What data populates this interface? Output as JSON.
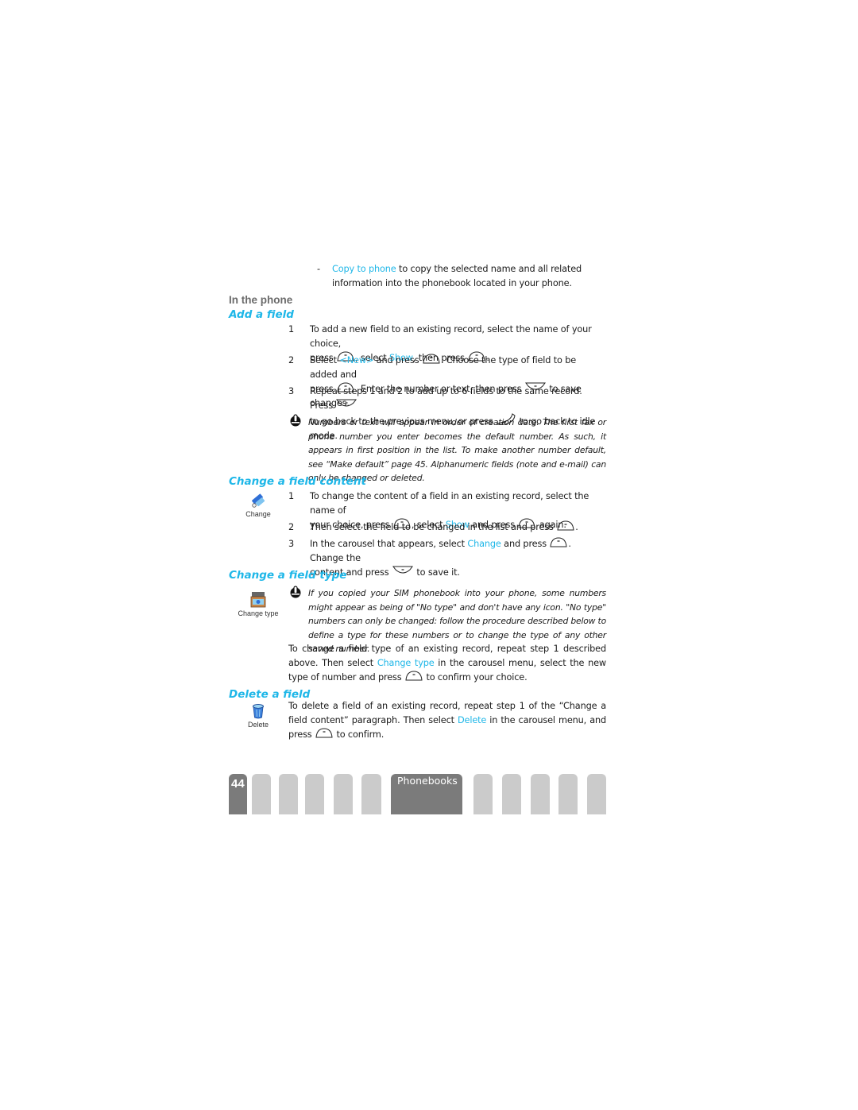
{
  "intro_bullet": {
    "dash": "-",
    "link": "Copy to phone",
    "text_1": " to copy the selected name and all related",
    "text_2": "information into the phonebook located in your phone."
  },
  "subsection": "In the phone",
  "add_field": {
    "title": "Add a field",
    "steps": [
      {
        "num": "1",
        "a": "To add a new field to an existing record, select the name of your choice,",
        "b": "press",
        "c": ", select ",
        "link": "Show",
        "d": ", then press",
        "e": "."
      },
      {
        "num": "2",
        "a": "Select ",
        "link": "<New>",
        "b": " and press",
        "c": ". Choose the type of field to be added and",
        "d": "press",
        "e": ". Enter the number or text, then press",
        "f": "to save changes."
      },
      {
        "num": "3",
        "a": "Repeat steps 1 and 2 to add up to 6 fields to the same record. Press",
        "b": "to go back to the previous menu, or press",
        "c": "to go back to idle mode."
      }
    ],
    "note": "Numbers or text will appear in order of creation date. The first fax or phone number you enter becomes the default number. As such, it appears in first position in the list. To make another number default, see “Make default” page 45. Alphanumeric fields (note and e-mail) can only be changed or deleted."
  },
  "change_content": {
    "title": "Change a field content",
    "icon_label": "Change",
    "steps": [
      {
        "num": "1",
        "a": "To change the content of a field in an existing record, select the name of",
        "b": "your choice, press",
        "c": ", select ",
        "link": "Show",
        "d": " and press",
        "e": "again."
      },
      {
        "num": "2",
        "a": "Then select the field to be changed in the list and press",
        "b": "."
      },
      {
        "num": "3",
        "a": "In the carousel that appears, select ",
        "link": "Change",
        "b": " and press",
        "c": ". Change the",
        "d": "content and press",
        "e": "to save it."
      }
    ]
  },
  "change_type": {
    "title": "Change a field type",
    "icon_label": "Change type",
    "note": "If you copied your SIM phonebook into your phone, some numbers might appear as being of \"No type\" and don't have any icon. \"No type\" numbers can only be changed: follow the procedure described below to define a type for these numbers or to change the type of any other saved number.",
    "para_a": "To change a field type of an existing record, repeat step 1 described above. Then select ",
    "link": "Change type",
    "para_b": " in the carousel menu, select the new type of number and press",
    "para_c": "to confirm your choice."
  },
  "delete_field": {
    "title": "Delete a field",
    "icon_label": "Delete",
    "para_a": "To delete a field of an existing record, repeat step 1 of the “Change a field content” paragraph. Then select ",
    "link": "Delete",
    "para_b": " in the carousel menu, and press",
    "para_c": "to confirm."
  },
  "footer": {
    "page_number": "44",
    "chapter": "Phonebooks"
  },
  "colors": {
    "accent": "#1fb7e8",
    "tab_active": "#7b7b7b",
    "tab_inactive": "#cbcbcb"
  }
}
